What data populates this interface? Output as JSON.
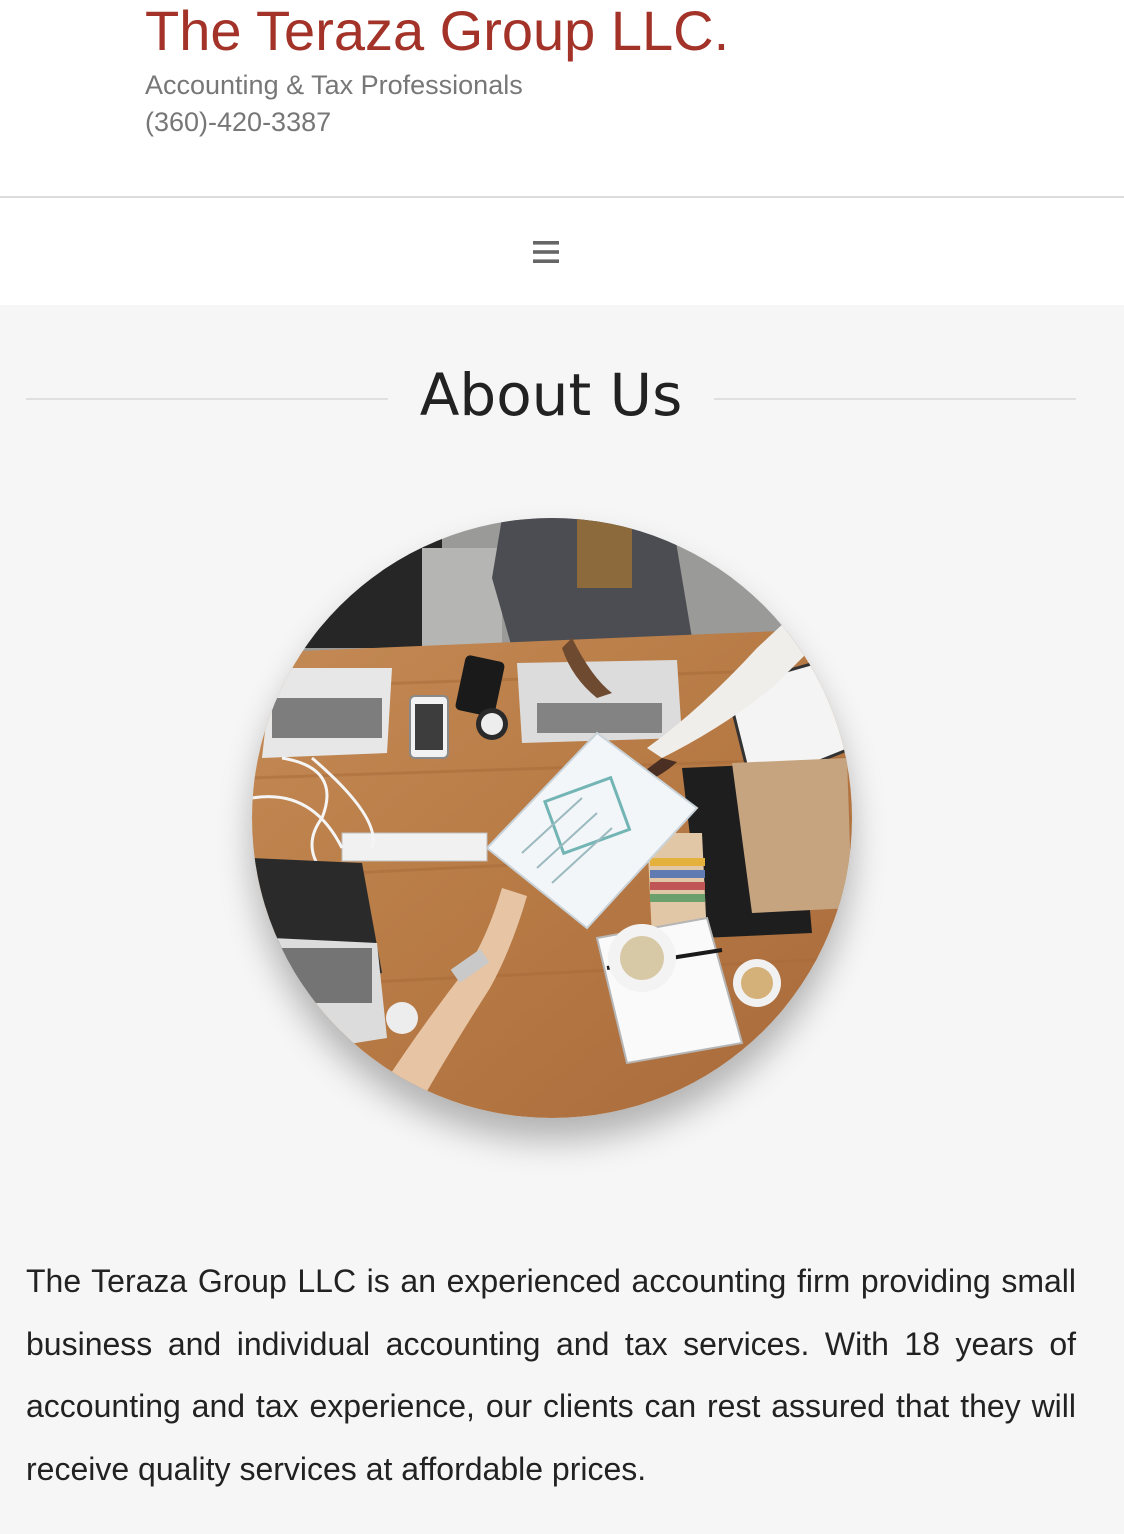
{
  "site": {
    "title": "The Teraza Group LLC.",
    "tagline": "Accounting & Tax Professionals",
    "phone": "(360)-420-3387",
    "brand_color": "#a33228"
  },
  "nav": {
    "menu_icon": "hamburger-menu-icon"
  },
  "about": {
    "heading": "About Us",
    "image_icon": "meeting-photo",
    "paragraph": "The Teraza Group LLC is an experienced accounting firm providing small business and individual accounting and tax services. With 18 years of accounting and tax experience, our clients can rest assured that they will receive quality services at affordable prices."
  }
}
